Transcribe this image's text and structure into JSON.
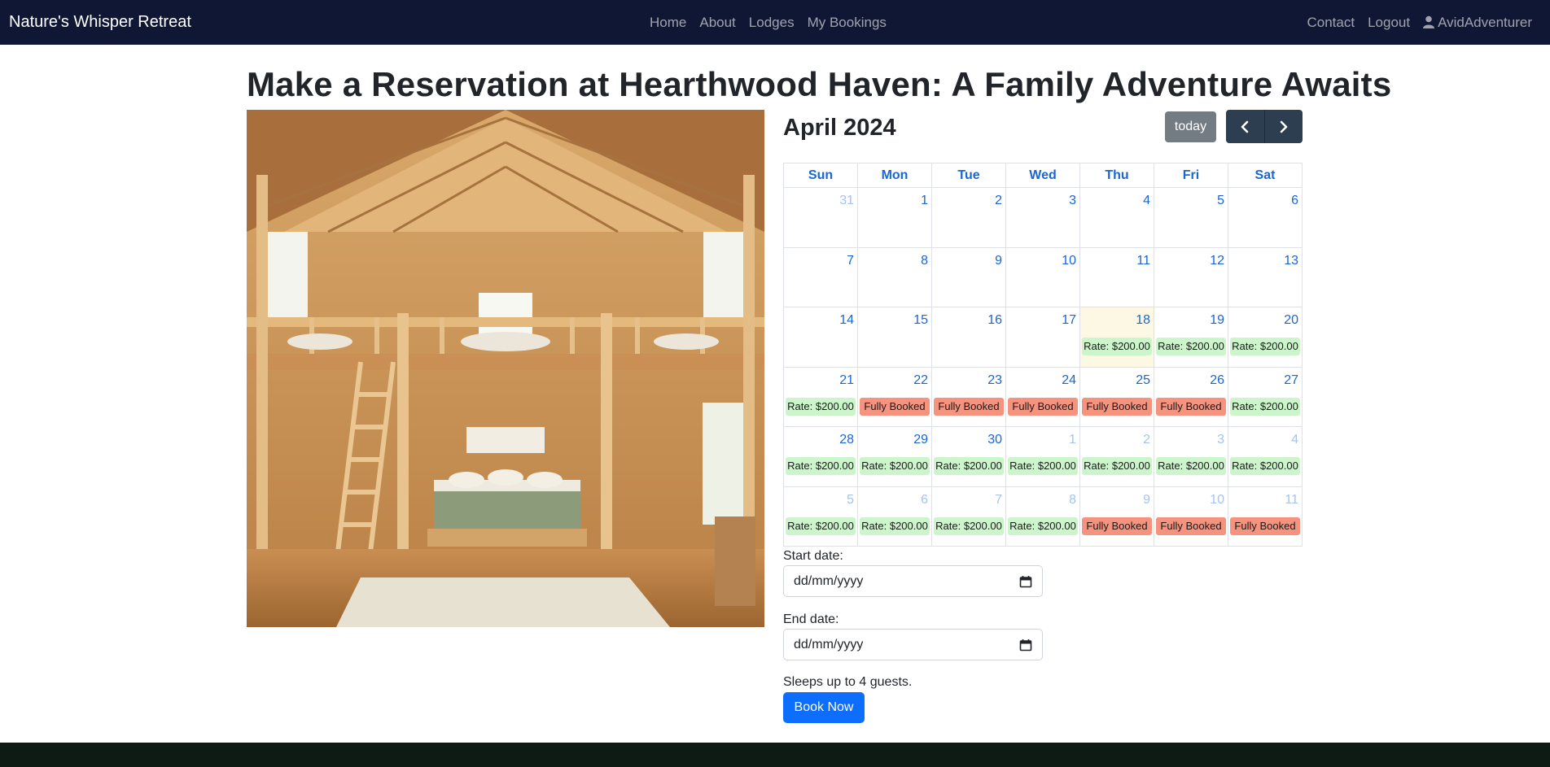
{
  "nav": {
    "brand": "Nature's Whisper Retreat",
    "links": [
      "Home",
      "About",
      "Lodges",
      "My Bookings"
    ],
    "right": {
      "contact": "Contact",
      "logout": "Logout",
      "user": "AvidAdventurer"
    }
  },
  "page": {
    "title": "Make a Reservation at Hearthwood Haven: A Family Adventure Awaits"
  },
  "calendar": {
    "title": "April 2024",
    "today_label": "today",
    "weekdays": [
      "Sun",
      "Mon",
      "Tue",
      "Wed",
      "Thu",
      "Fri",
      "Sat"
    ],
    "weeks": [
      [
        {
          "d": "31",
          "other": true
        },
        {
          "d": "1"
        },
        {
          "d": "2"
        },
        {
          "d": "3"
        },
        {
          "d": "4"
        },
        {
          "d": "5"
        },
        {
          "d": "6"
        }
      ],
      [
        {
          "d": "7"
        },
        {
          "d": "8"
        },
        {
          "d": "9"
        },
        {
          "d": "10"
        },
        {
          "d": "11"
        },
        {
          "d": "12"
        },
        {
          "d": "13"
        }
      ],
      [
        {
          "d": "14"
        },
        {
          "d": "15"
        },
        {
          "d": "16"
        },
        {
          "d": "17"
        },
        {
          "d": "18",
          "today": true,
          "ev": "rate"
        },
        {
          "d": "19",
          "ev": "rate"
        },
        {
          "d": "20",
          "ev": "rate"
        }
      ],
      [
        {
          "d": "21",
          "ev": "rate"
        },
        {
          "d": "22",
          "ev": "booked"
        },
        {
          "d": "23",
          "ev": "booked"
        },
        {
          "d": "24",
          "ev": "booked"
        },
        {
          "d": "25",
          "ev": "booked"
        },
        {
          "d": "26",
          "ev": "booked"
        },
        {
          "d": "27",
          "ev": "rate"
        }
      ],
      [
        {
          "d": "28",
          "ev": "rate"
        },
        {
          "d": "29",
          "ev": "rate"
        },
        {
          "d": "30",
          "ev": "rate"
        },
        {
          "d": "1",
          "other": true,
          "ev": "rate"
        },
        {
          "d": "2",
          "other": true,
          "ev": "rate"
        },
        {
          "d": "3",
          "other": true,
          "ev": "rate"
        },
        {
          "d": "4",
          "other": true,
          "ev": "rate"
        }
      ],
      [
        {
          "d": "5",
          "other": true,
          "ev": "rate"
        },
        {
          "d": "6",
          "other": true,
          "ev": "rate"
        },
        {
          "d": "7",
          "other": true,
          "ev": "rate"
        },
        {
          "d": "8",
          "other": true,
          "ev": "rate"
        },
        {
          "d": "9",
          "other": true,
          "ev": "booked"
        },
        {
          "d": "10",
          "other": true,
          "ev": "booked"
        },
        {
          "d": "11",
          "other": true,
          "ev": "booked"
        }
      ]
    ],
    "event_labels": {
      "rate": "Rate: $200.00",
      "booked": "Fully Booked"
    },
    "colors": {
      "rate": "#ccf5cc",
      "booked": "#f5937f",
      "today": "#fcf8e3",
      "day": "#1a66d4"
    }
  },
  "form": {
    "start_label": "Start date:",
    "start_placeholder": "dd/mm/yyyy",
    "end_label": "End date:",
    "end_placeholder": "dd/mm/yyyy",
    "sleeps": "Sleeps up to 4 guests.",
    "book_label": "Book Now"
  },
  "icons": {
    "user": "user-icon",
    "prev": "chevron-left-icon",
    "next": "chevron-right-icon",
    "calendar": "calendar-icon"
  }
}
